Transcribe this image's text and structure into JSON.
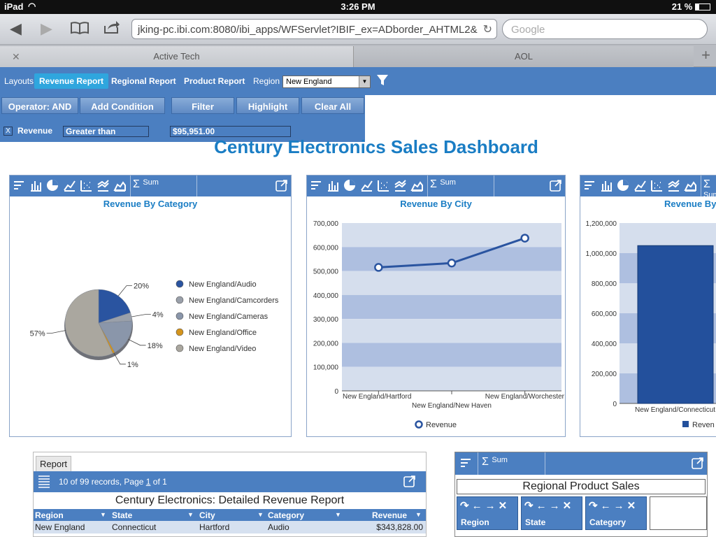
{
  "status": {
    "device": "iPad",
    "time": "3:26 PM",
    "battery": "21 %"
  },
  "browser": {
    "url": "jking-pc.ibi.com:8080/ibi_apps/WFServlet?IBIF_ex=ADborder_AHTML2&",
    "search_placeholder": "Google",
    "tabs": [
      {
        "label": "Active Tech"
      },
      {
        "label": "AOL"
      }
    ]
  },
  "appbar": {
    "layouts": "Layouts",
    "tabs": [
      {
        "label": "Revenue Report"
      },
      {
        "label": "Regional Report"
      },
      {
        "label": "Product Report"
      }
    ],
    "region_label": "Region",
    "region_value": "New England"
  },
  "filter": {
    "buttons": [
      "Operator: AND",
      "Add Condition",
      "Filter",
      "Highlight",
      "Clear All"
    ],
    "condition": {
      "field": "Revenue",
      "operator": "Greater than",
      "value": "$95,951.00",
      "checkbox": "X"
    }
  },
  "dashboard_title": "Century Electronics Sales Dashboard",
  "toolbar_sum": "Sum",
  "chart_data": [
    {
      "type": "pie",
      "title": "Revenue By Category",
      "categories": [
        "New England/Audio",
        "New England/Camcorders",
        "New England/Cameras",
        "New England/Office",
        "New England/Video"
      ],
      "values": [
        20,
        4,
        18,
        1,
        57
      ],
      "labels": [
        "20%",
        "4%",
        "18%",
        "1%",
        "57%"
      ],
      "colors": [
        "#2a54a0",
        "#9aa0aa",
        "#8a96aa",
        "#d4941c",
        "#aaa79f"
      ],
      "legend": "right"
    },
    {
      "type": "line",
      "title": "Revenue By City",
      "categories": [
        "New England/Hartford",
        "New England/New Haven",
        "New England/Worchester"
      ],
      "series": [
        {
          "name": "Revenue",
          "values": [
            515000,
            533000,
            637000
          ]
        }
      ],
      "xlabel": "",
      "ylabel": "",
      "ylim": [
        0,
        700000
      ],
      "yticks": [
        "0",
        "100,000",
        "200,000",
        "300,000",
        "400,000",
        "500,000",
        "600,000",
        "700,000"
      ],
      "legend": "bottom"
    },
    {
      "type": "bar",
      "title": "Revenue By",
      "categories": [
        "New England/Connecticut"
      ],
      "series": [
        {
          "name": "Reven",
          "values": [
            1050000
          ]
        }
      ],
      "ylim": [
        0,
        1200000
      ],
      "yticks": [
        "0",
        "200,000",
        "400,000",
        "600,000",
        "800,000",
        "1,000,000",
        "1,200,000"
      ],
      "legend": "bottom"
    }
  ],
  "report": {
    "tab": "Report",
    "records": "10 of 99 records, Page",
    "page": "1",
    "of": "of 1",
    "title": "Century Electronics: Detailed Revenue Report",
    "columns": [
      "Region",
      "State",
      "City",
      "Category",
      "Revenue"
    ],
    "rows": [
      [
        "New England",
        "Connecticut",
        "Hartford",
        "Audio",
        "$343,828.00"
      ]
    ]
  },
  "regional": {
    "title": "Regional Product Sales",
    "columns": [
      "Region",
      "State",
      "Category"
    ]
  }
}
